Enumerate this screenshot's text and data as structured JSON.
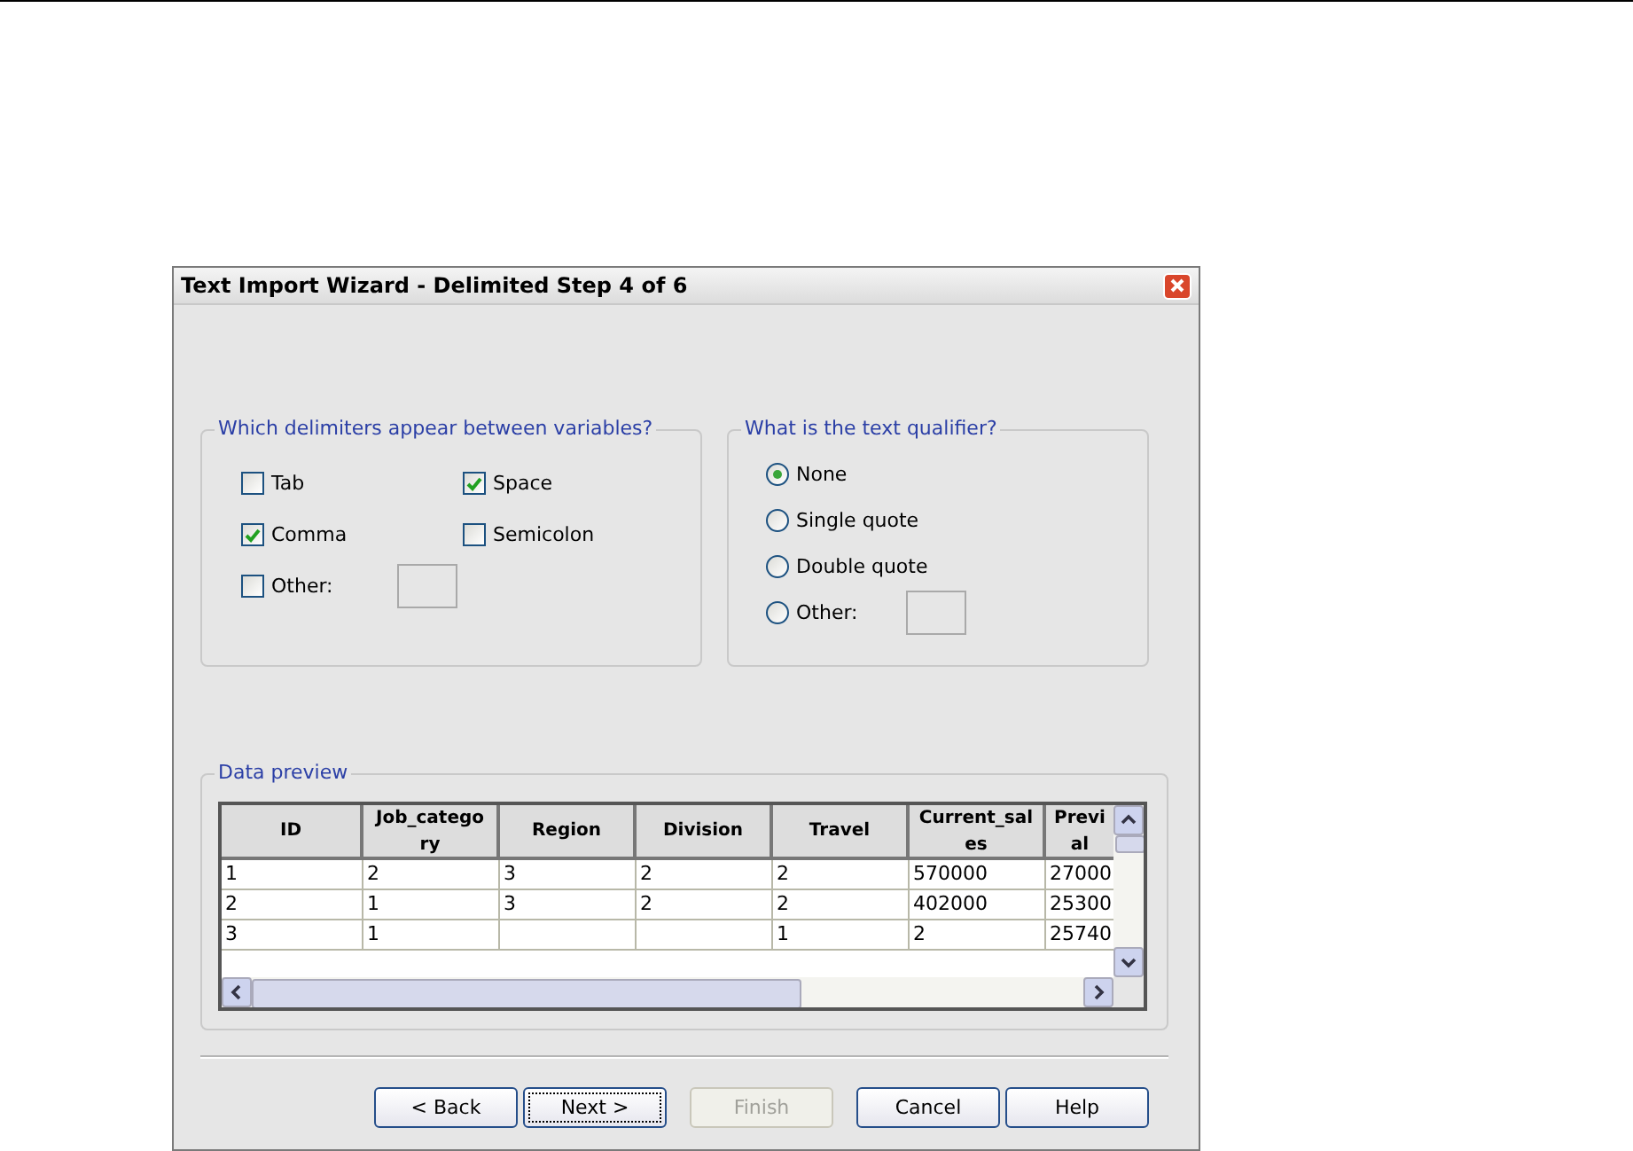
{
  "window": {
    "title": "Text Import Wizard - Delimited Step 4 of 6"
  },
  "delimiters": {
    "title": "Which delimiters appear between variables?",
    "options": [
      {
        "label": "Tab",
        "checked": false
      },
      {
        "label": "Space",
        "checked": true
      },
      {
        "label": "Comma",
        "checked": true
      },
      {
        "label": "Semicolon",
        "checked": false
      },
      {
        "label": "Other:",
        "checked": false,
        "kind": "with-field"
      }
    ]
  },
  "qualifier": {
    "title": "What is the text qualifier?",
    "options": [
      {
        "label": "None",
        "selected": true
      },
      {
        "label": "Single quote",
        "selected": false
      },
      {
        "label": "Double quote",
        "selected": false
      },
      {
        "label": "Other:",
        "selected": false,
        "kind": "with-field"
      }
    ]
  },
  "preview": {
    "title": "Data preview",
    "columns": [
      "ID",
      "Job_catego\nry",
      "Region",
      "Division",
      "Travel",
      "Current_sal\nes",
      "Previ\nal"
    ],
    "rows": [
      [
        "1",
        "2",
        "3",
        "2",
        "2",
        "570000",
        "27000"
      ],
      [
        "2",
        "1",
        "3",
        "2",
        "2",
        "402000",
        "25300"
      ],
      [
        "3",
        "1",
        "",
        "",
        "1",
        "2",
        "25740"
      ]
    ]
  },
  "buttons": [
    {
      "label": "< Back",
      "disabled": false
    },
    {
      "label": "Next >",
      "disabled": false,
      "focused": true
    },
    {
      "label": "Finish",
      "disabled": true
    },
    {
      "label": "Cancel",
      "disabled": false
    },
    {
      "label": "Help",
      "disabled": false
    }
  ]
}
